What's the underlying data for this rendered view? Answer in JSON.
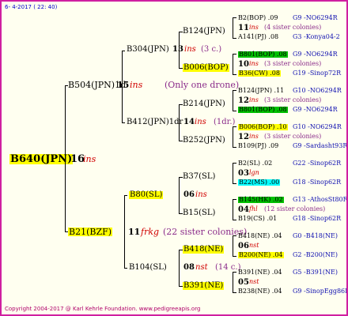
{
  "header": {
    "date": "6- 4-2017 ( 22: 40)"
  },
  "footer": {
    "copyright": "Copyright 2004-2017 @ Karl Kehrle Foundation.   www.pedigreeapis.org"
  },
  "colors": {
    "border": "#d01fa0",
    "yellow": "#ffff00",
    "green": "#00c000",
    "cyan": "#00ffff",
    "red": "#d00000",
    "purple": "#8a2a8a",
    "blue": "#1010b0"
  },
  "tree": {
    "root": {
      "name": "B640(JPN)",
      "year": "16",
      "suffix": "ins"
    },
    "sire": {
      "name": "B504(JPN)1d",
      "year": "15",
      "suffix": "ins",
      "note": "(Only one drone)"
    },
    "dam": {
      "name": "B21(BZF)",
      "year": "11",
      "suffix": "frkg",
      "note": "(22 sister colonies)"
    },
    "sire_sire": {
      "name": "B304(JPN)",
      "year": "13",
      "suffix": "ins",
      "note": "(3 c.)"
    },
    "sire_dam": {
      "name": "B412(JPN)1dr",
      "year": "14",
      "suffix": "ins",
      "note": "(1dr.)"
    },
    "dam_sire": {
      "name": "B80(SL)",
      "year": "06",
      "suffix": "ins"
    },
    "dam_dam": {
      "name": "B104(SL)",
      "year": "08",
      "suffix": "nst",
      "note": "(14 c.)"
    },
    "g3": [
      {
        "name": "B124(JPN)",
        "year": "11",
        "suffix": "ins",
        "note": "(4 sister colonies)"
      },
      {
        "name": "B006(BOP)",
        "year": "10",
        "suffix": "ins",
        "note": "(3 sister colonies)"
      },
      {
        "name": "B214(JPN)",
        "year": "12",
        "suffix": "ins",
        "note": "(3 sister colonies)"
      },
      {
        "name": "B252(JPN)",
        "year": "12",
        "suffix": "ins",
        "note": "(3 sister colonies)"
      },
      {
        "name": "B37(SL)",
        "year": "03",
        "suffix": "lgn"
      },
      {
        "name": "B15(SL)",
        "year": "04",
        "suffix": "fhl",
        "note": "(12 sister colonies)"
      },
      {
        "name": "B418(NE)",
        "year": "06",
        "suffix": "nst"
      },
      {
        "name": "B391(NE)",
        "year": "05",
        "suffix": "nst"
      }
    ],
    "g4": [
      {
        "left": "B2(BOP) .09",
        "right": "G9 -NO6294R"
      },
      {
        "left": "A141(PJ) .08",
        "right": "G3 -Konya04-2"
      },
      {
        "left": "B801(BOP) .08",
        "right": "G9 -NO6294R"
      },
      {
        "left": "B36(CW) .08",
        "right": "G19 -Sinop72R"
      },
      {
        "left": "B124(JPN) .11",
        "right": "G10 -NO6294R"
      },
      {
        "left": "B801(BOP) .08",
        "right": "G9 -NO6294R"
      },
      {
        "left": "B006(BOP) .10",
        "right": "G10 -NO6294R"
      },
      {
        "left": "B109(PJ) .09",
        "right": "G9 -Sardasht93R"
      },
      {
        "left": "B2(SL) .02",
        "right": "G22 -Sinop62R"
      },
      {
        "left": "B22(MS) .00",
        "right": "G18 -Sinop62R"
      },
      {
        "left": "B145(HK) .02",
        "right": "G13 -AthosSt80R"
      },
      {
        "left": "B19(CS) .01",
        "right": "G18 -Sinop62R"
      },
      {
        "left": "B418(NE) .04",
        "right": "G0 -B418(NE)"
      },
      {
        "left": "B200(NE) .04",
        "right": "G2 -B200(NE)"
      },
      {
        "left": "B391(NE) .04",
        "right": "G5 -B391(NE)"
      },
      {
        "left": "B238(NE) .04",
        "right": "G9 -SinopEgg86R"
      }
    ]
  }
}
